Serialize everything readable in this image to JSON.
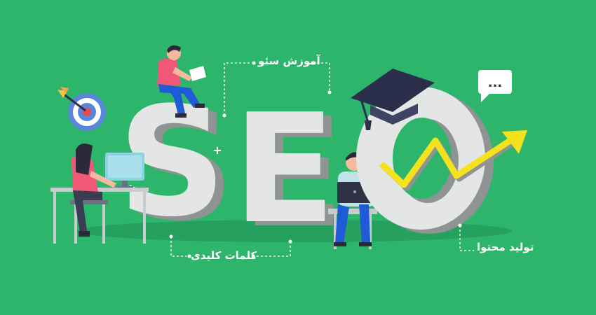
{
  "colors": {
    "background": "#2db56c",
    "letter_face": "#e4e6e5",
    "letter_side": "#8f9391",
    "accent_yellow": "#f4e21c",
    "cap": "#2b2f4b",
    "target_blue": "#5b86d8",
    "target_red": "#e74c4c",
    "shirt_pink": "#ef5876",
    "pants_blue": "#1f5bd6",
    "skin": "#f6b9a0"
  },
  "hero": {
    "letters": [
      "S",
      "E",
      "O"
    ]
  },
  "labels": {
    "seo_training": "آموزش سئو",
    "keywords": "کلمات کلیدی",
    "content_production": "تولید محتوا"
  },
  "speech_bubble": {
    "text": "..."
  },
  "icons": [
    "target-icon",
    "arrow-icon",
    "graduation-cap-icon",
    "speech-bubble-icon",
    "trend-arrow-icon",
    "monitor-icon",
    "laptop-icon",
    "paper-icon",
    "plus-icon"
  ]
}
